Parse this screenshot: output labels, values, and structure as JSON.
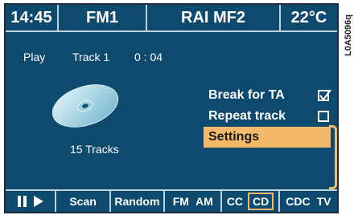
{
  "header": {
    "time": "14:45",
    "band": "FM1",
    "station": "RAI MF2",
    "temperature": "22°C"
  },
  "status": {
    "mode": "Play",
    "track": "Track 1",
    "elapsed": "0 : 04"
  },
  "disc": {
    "tracks": "15 Tracks"
  },
  "menu": {
    "break_for_ta": {
      "label": "Break for TA",
      "checked": true
    },
    "repeat_track": {
      "label": "Repeat track",
      "checked": false
    },
    "settings": {
      "label": "Settings",
      "selected": true
    }
  },
  "bottom": {
    "scan": "Scan",
    "random": "Random",
    "fm": "FM",
    "am": "AM",
    "cc": "CC",
    "cd": "CD",
    "cdc": "CDC",
    "tv": "TV"
  },
  "figure_code": "L0A5096q",
  "colors": {
    "screen_bg": "#0d4a6d",
    "highlight": "#f5b96b",
    "text": "#ffffff"
  }
}
